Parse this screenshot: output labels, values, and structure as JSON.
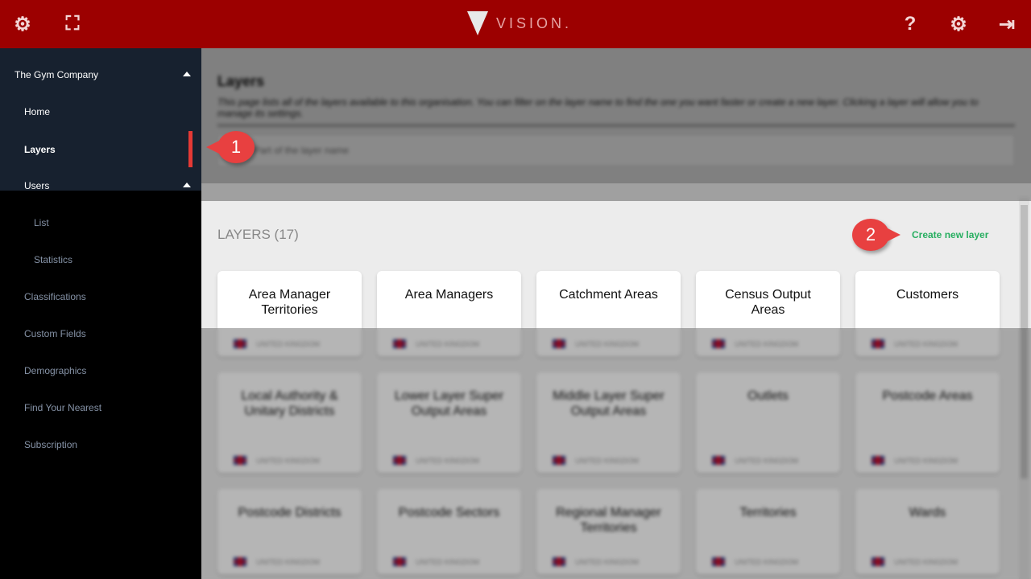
{
  "header": {
    "logo_text": "VISION.",
    "icons": [
      "settings-cog-icon",
      "map-icon",
      "help-icon",
      "gear-icon",
      "logout-icon"
    ]
  },
  "sidebar": {
    "org": "The Gym Company",
    "items": [
      {
        "label": "Home"
      },
      {
        "label": "Layers"
      },
      {
        "label": "Users"
      },
      {
        "label": "List"
      },
      {
        "label": "Statistics"
      },
      {
        "label": "Classifications"
      },
      {
        "label": "Custom Fields"
      },
      {
        "label": "Demographics"
      },
      {
        "label": "Find Your Nearest"
      },
      {
        "label": "Subscription"
      }
    ]
  },
  "main": {
    "title": "Layers",
    "description": "This page lists all of the layers available to this organisation. You can filter on the layer name to find the one you want faster or create a new layer. Clicking a layer will allow you to manage its settings.",
    "search_placeholder": "Part of the layer name",
    "layers_heading": "LAYERS (17)",
    "create_label": "Create new layer",
    "cards": [
      {
        "name": "Area Manager Territories",
        "country": "UNITED KINGDOM"
      },
      {
        "name": "Area Managers",
        "country": "UNITED KINGDOM"
      },
      {
        "name": "Catchment Areas",
        "country": "UNITED KINGDOM"
      },
      {
        "name": "Census Output Areas",
        "country": "UNITED KINGDOM"
      },
      {
        "name": "Customers",
        "country": "UNITED KINGDOM"
      },
      {
        "name": "Local Authority & Unitary Districts",
        "country": "UNITED KINGDOM"
      },
      {
        "name": "Lower Layer Super Output Areas",
        "country": "UNITED KINGDOM"
      },
      {
        "name": "Middle Layer Super Output Areas",
        "country": "UNITED KINGDOM"
      },
      {
        "name": "Outlets",
        "country": "UNITED KINGDOM"
      },
      {
        "name": "Postcode Areas",
        "country": "UNITED KINGDOM"
      },
      {
        "name": "Postcode Districts",
        "country": "UNITED KINGDOM"
      },
      {
        "name": "Postcode Sectors",
        "country": "UNITED KINGDOM"
      },
      {
        "name": "Regional Manager Territories",
        "country": "UNITED KINGDOM"
      },
      {
        "name": "Territories",
        "country": "UNITED KINGDOM"
      },
      {
        "name": "Wards",
        "country": "UNITED KINGDOM"
      }
    ]
  },
  "callouts": [
    "1",
    "2"
  ],
  "colors": {
    "header": "#9c0000",
    "sidebar": "#17212f",
    "accent": "#27ae60",
    "callout": "#e84040"
  }
}
